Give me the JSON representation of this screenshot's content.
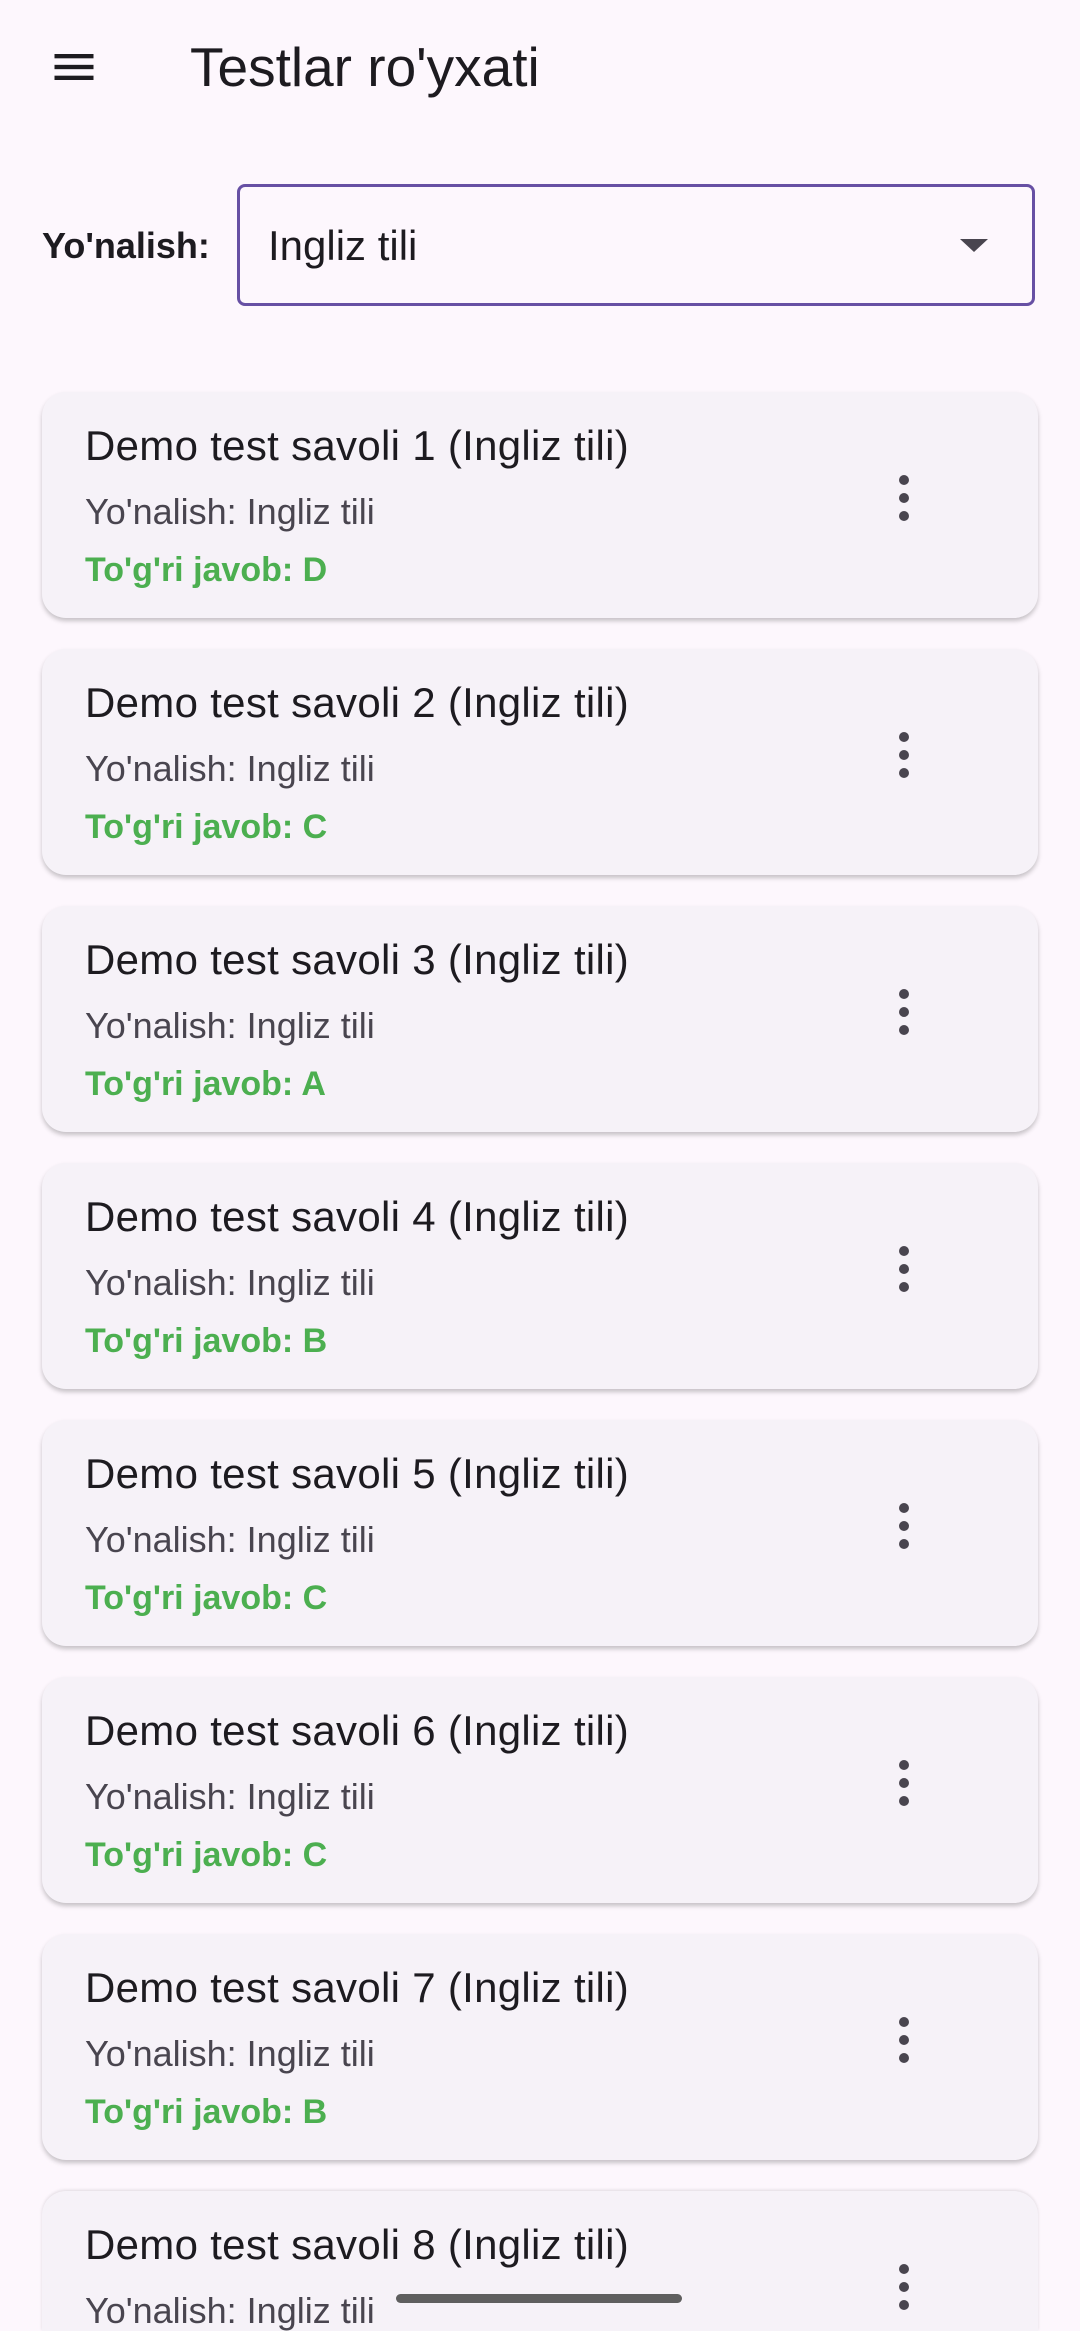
{
  "appbar": {
    "title": "Testlar ro'yxati",
    "menu_icon": "menu-icon"
  },
  "filter": {
    "label": "Yo'nalish:",
    "selected": "Ingliz tili",
    "accent_color": "#6750a4"
  },
  "tests": [
    {
      "title": "Demo test savoli 1 (Ingliz tili)",
      "direction": "Yo'nalish: Ingliz tili",
      "answer": "To'g'ri javob: D"
    },
    {
      "title": "Demo test savoli 2 (Ingliz tili)",
      "direction": "Yo'nalish: Ingliz tili",
      "answer": "To'g'ri javob: C"
    },
    {
      "title": "Demo test savoli 3 (Ingliz tili)",
      "direction": "Yo'nalish: Ingliz tili",
      "answer": "To'g'ri javob: A"
    },
    {
      "title": "Demo test savoli 4 (Ingliz tili)",
      "direction": "Yo'nalish: Ingliz tili",
      "answer": "To'g'ri javob: B"
    },
    {
      "title": "Demo test savoli 5 (Ingliz tili)",
      "direction": "Yo'nalish: Ingliz tili",
      "answer": "To'g'ri javob: C"
    },
    {
      "title": "Demo test savoli 6 (Ingliz tili)",
      "direction": "Yo'nalish: Ingliz tili",
      "answer": "To'g'ri javob: C"
    },
    {
      "title": "Demo test savoli 7 (Ingliz tili)",
      "direction": "Yo'nalish: Ingliz tili",
      "answer": "To'g'ri javob: B"
    },
    {
      "title": "Demo test savoli 8 (Ingliz tili)",
      "direction": "Yo'nalish: Ingliz tili",
      "answer": ""
    }
  ],
  "colors": {
    "background": "#fdf7fd",
    "card": "#f6f2f8",
    "answer_green": "#4caf50"
  }
}
